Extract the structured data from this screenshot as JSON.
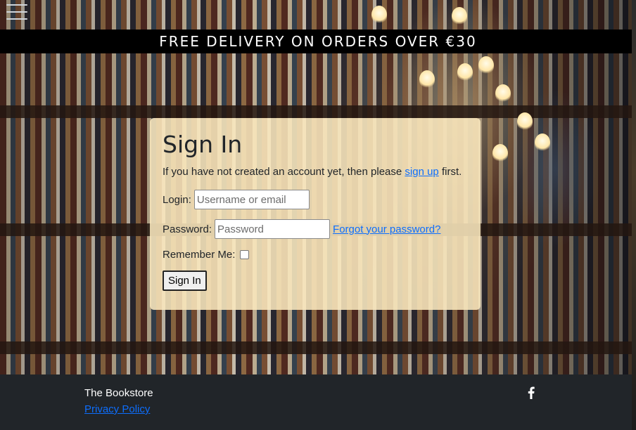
{
  "nav": {
    "menu_icon": "hamburger-menu-icon"
  },
  "banner": {
    "text": "FREE DELIVERY ON ORDERS OVER €30"
  },
  "signin": {
    "title": "Sign In",
    "intro_before": "If you have not created an account yet, then please ",
    "signup_link": "sign up",
    "intro_after": " first.",
    "login_label": "Login:",
    "login_placeholder": "Username or email",
    "login_value": "",
    "password_label": "Password:",
    "password_placeholder": "Password",
    "password_value": "",
    "forgot_link": "Forgot your password?",
    "remember_label": "Remember Me:",
    "remember_checked": false,
    "submit_label": "Sign In"
  },
  "footer": {
    "brand": "The Bookstore",
    "privacy_link": "Privacy Policy",
    "social_icon": "facebook-icon"
  },
  "colors": {
    "banner_bg": "#000000",
    "card_bg": "#fae8be",
    "link": "#0d6efd",
    "footer_bg": "#212529"
  }
}
